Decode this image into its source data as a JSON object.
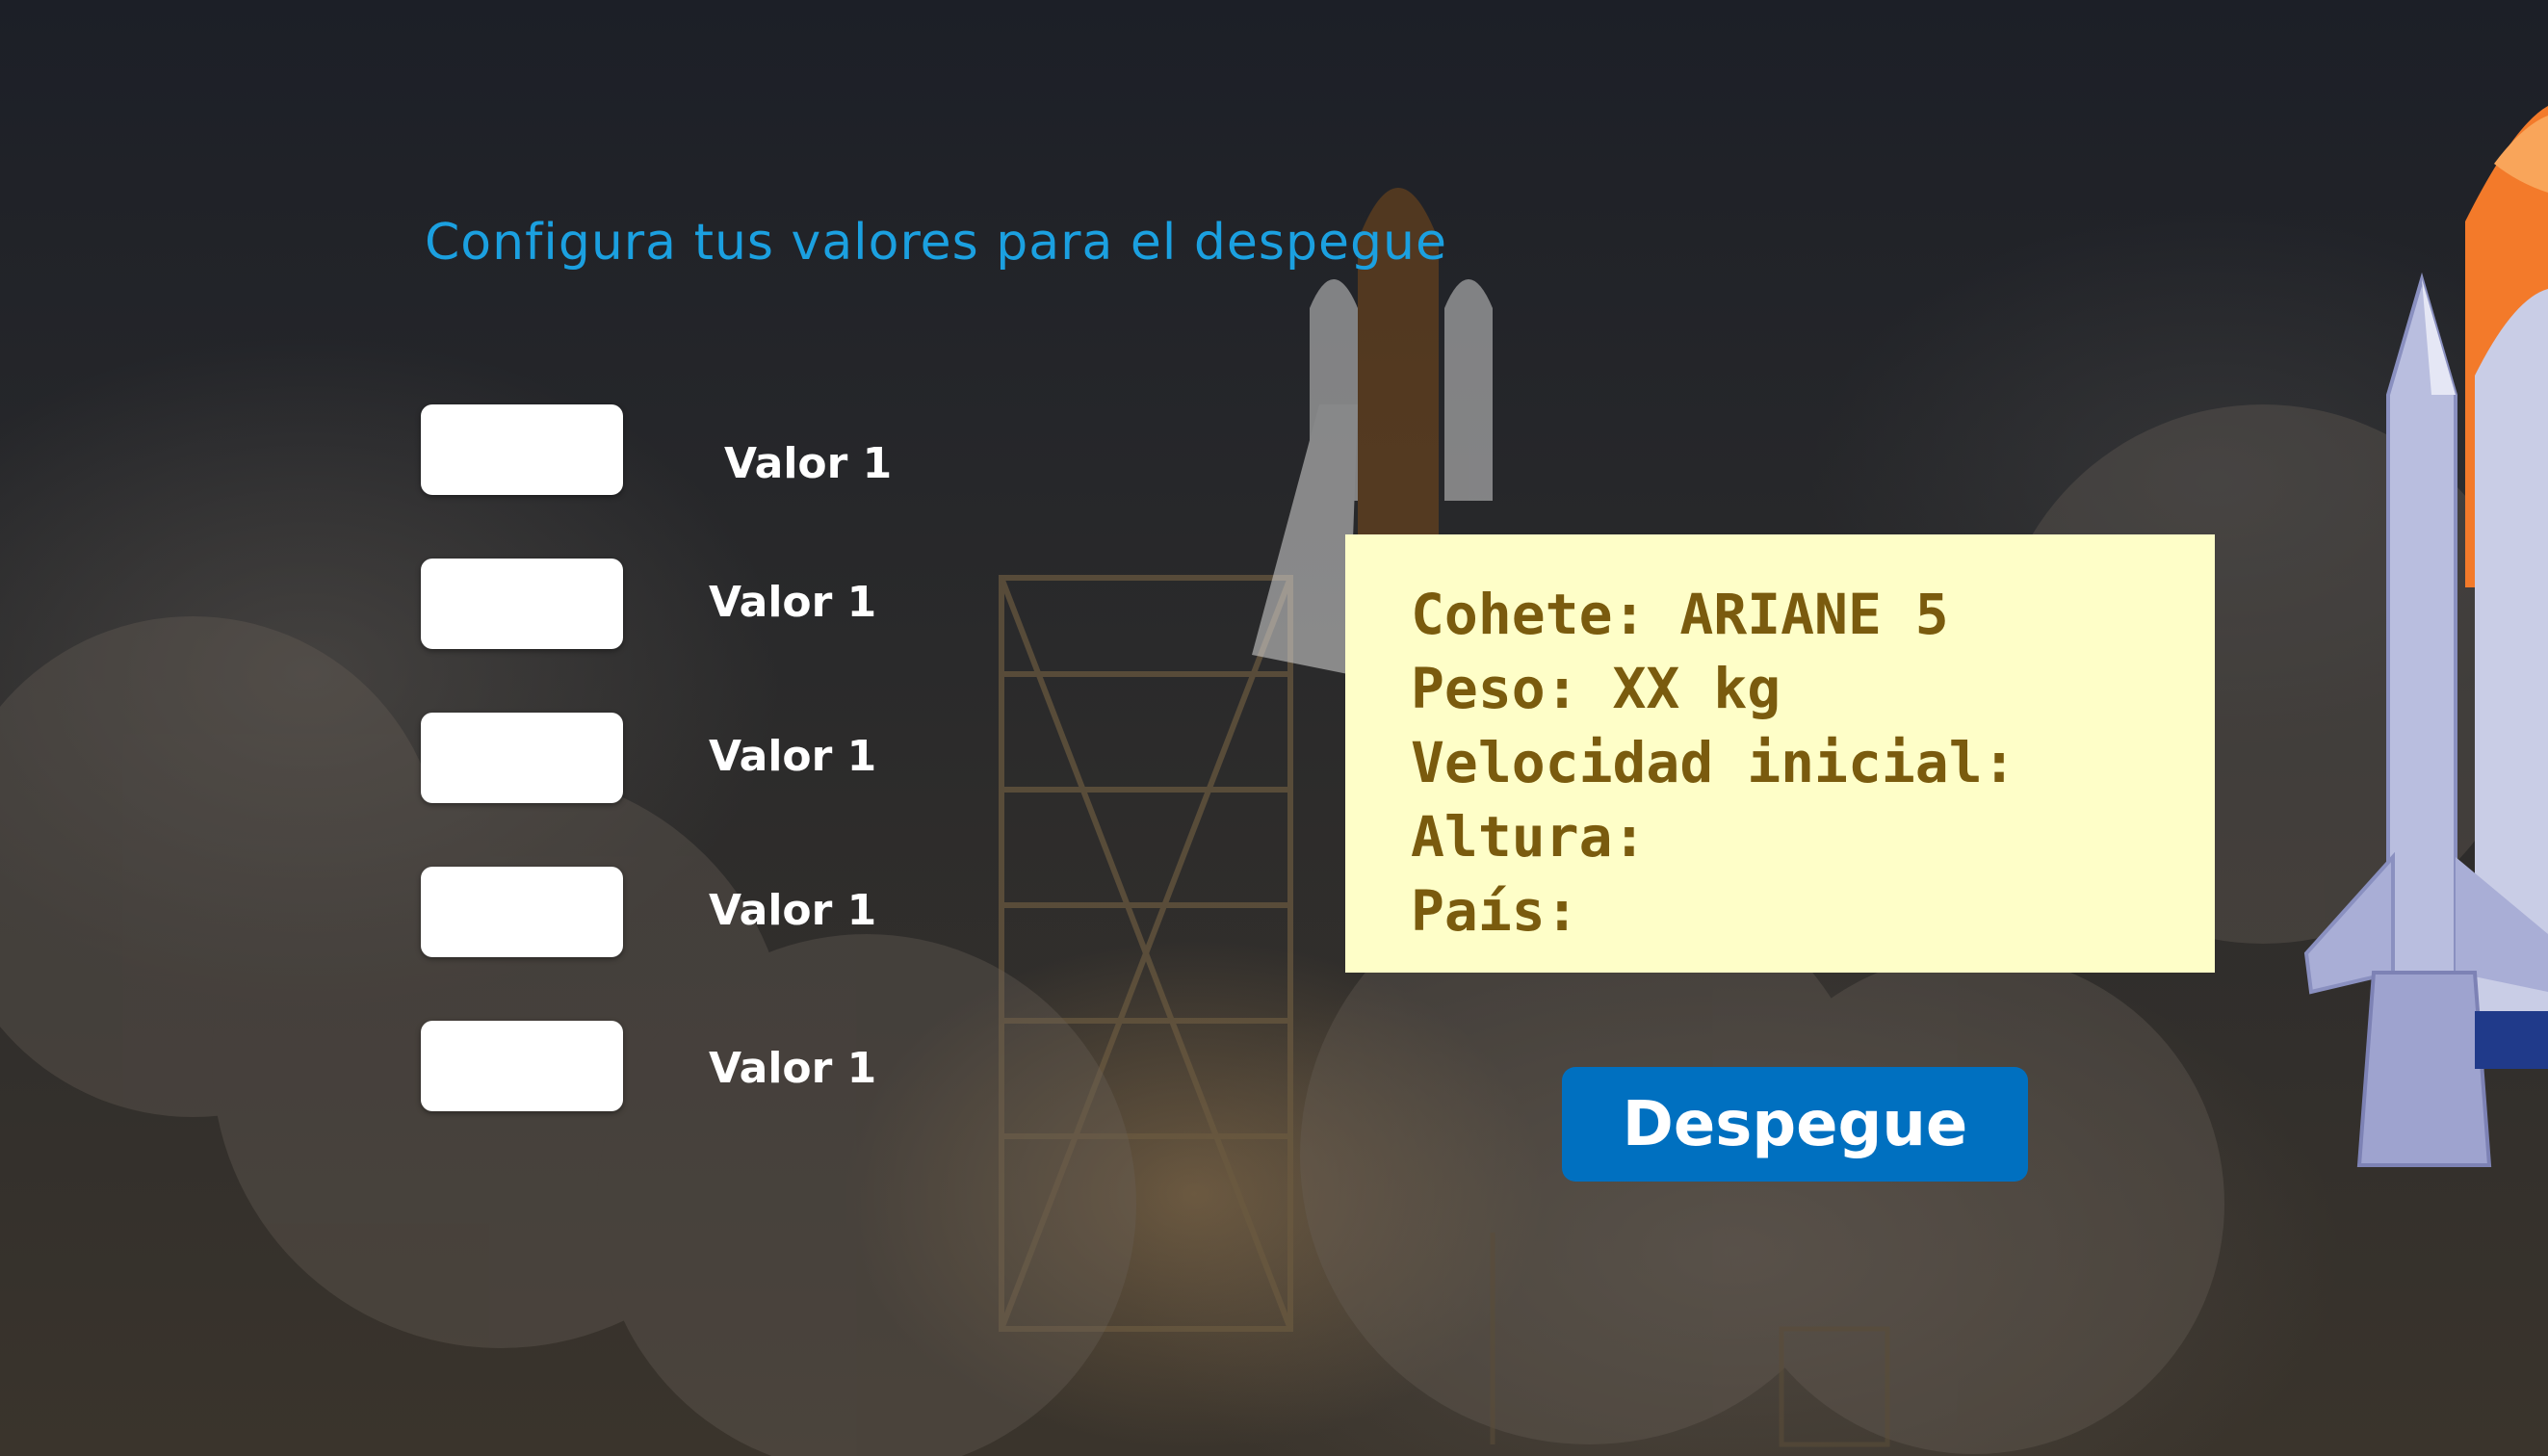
{
  "title": "Configura tus valores para el despegue",
  "inputs": [
    {
      "label": "Valor 1",
      "value": ""
    },
    {
      "label": "Valor 1",
      "value": ""
    },
    {
      "label": "Valor 1",
      "value": ""
    },
    {
      "label": "Valor 1",
      "value": ""
    },
    {
      "label": "Valor 1",
      "value": ""
    }
  ],
  "info": {
    "line1": "Cohete: ARIANE 5",
    "line2": "Peso: XX kg",
    "line3": "Velocidad inicial:",
    "line4": "Altura:",
    "line5": "País:"
  },
  "button": {
    "label": "Despegue"
  },
  "colors": {
    "title": "#1ba0e0",
    "info_bg": "#fefec8",
    "info_text": "#7a5b0e",
    "button": "#0070c0"
  },
  "icons": {
    "rocket": "rocket-icon",
    "background": "shuttle-launch-photo"
  }
}
